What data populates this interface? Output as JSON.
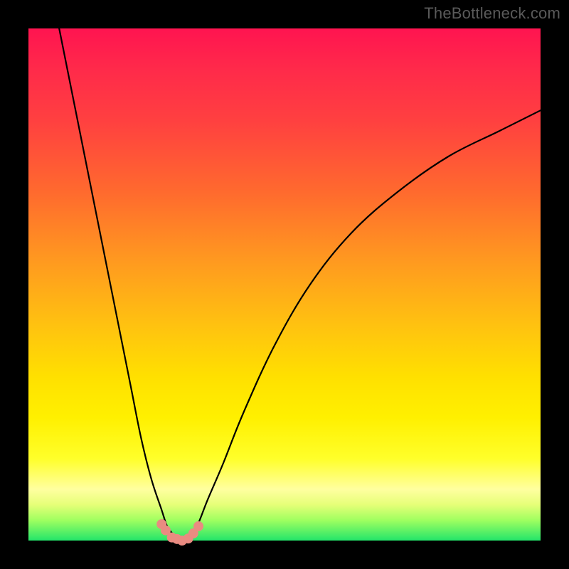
{
  "watermark": "TheBottleneck.com",
  "colors": {
    "bg": "#000000",
    "curve": "#000000",
    "marker": "#e98b81"
  },
  "chart_data": {
    "type": "line",
    "title": "",
    "xlabel": "",
    "ylabel": "",
    "xlim": [
      0,
      100
    ],
    "ylim": [
      0,
      100
    ],
    "grid": false,
    "legend": false,
    "series": [
      {
        "name": "left-branch",
        "x": [
          6,
          10,
          15,
          18,
          20,
          22,
          24,
          26,
          27,
          28,
          29,
          30
        ],
        "y": [
          100,
          80,
          55,
          40,
          30,
          20,
          12,
          6,
          3,
          1.5,
          0.5,
          0
        ]
      },
      {
        "name": "right-branch",
        "x": [
          30,
          31.5,
          33,
          35,
          38,
          42,
          48,
          55,
          63,
          72,
          82,
          92,
          100
        ],
        "y": [
          0,
          1,
          3,
          8,
          15,
          25,
          38,
          50,
          60,
          68,
          75,
          80,
          84
        ]
      }
    ],
    "markers": {
      "name": "bottom-cluster",
      "points": [
        {
          "x": 26.0,
          "y": 3.2
        },
        {
          "x": 26.8,
          "y": 2.0
        },
        {
          "x": 28.0,
          "y": 0.6
        },
        {
          "x": 29.0,
          "y": 0.3
        },
        {
          "x": 30.0,
          "y": 0.0
        },
        {
          "x": 31.2,
          "y": 0.4
        },
        {
          "x": 32.2,
          "y": 1.4
        },
        {
          "x": 33.2,
          "y": 2.8
        }
      ]
    }
  }
}
